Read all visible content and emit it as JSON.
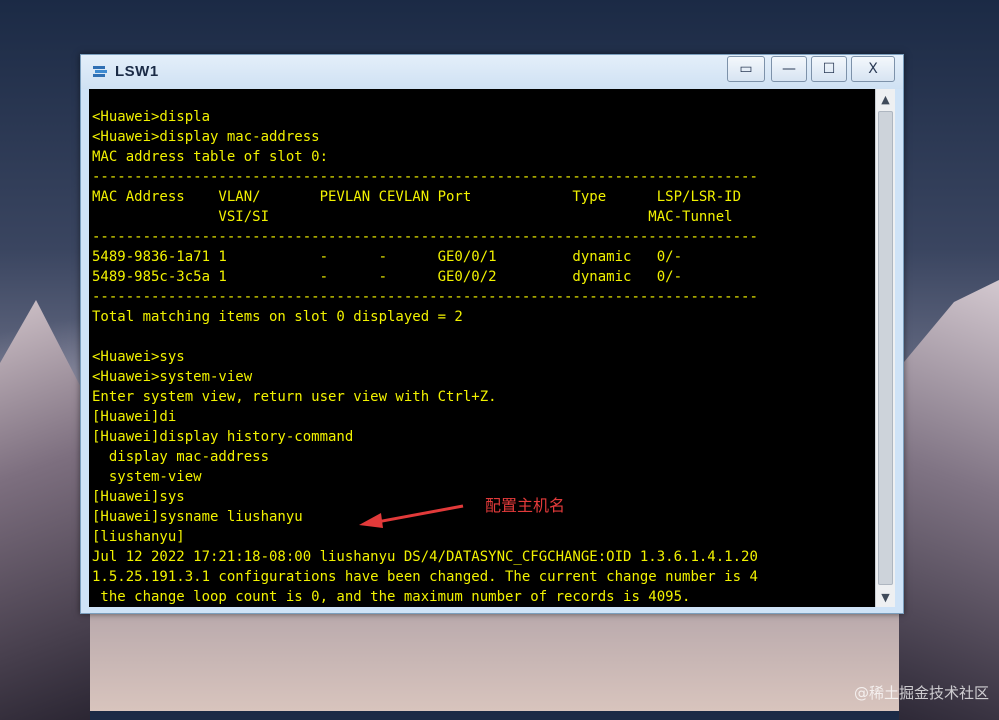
{
  "window": {
    "title": "LSW1",
    "controls": {
      "restore_glyph": "▭",
      "minimize_glyph": "—",
      "maximize_glyph": "☐",
      "close_glyph": "X"
    }
  },
  "terminal": {
    "text_color": "#f2f200",
    "lines": [
      "<Huawei>displa",
      "<Huawei>display mac-address",
      "MAC address table of slot 0:",
      "-------------------------------------------------------------------------------",
      "MAC Address    VLAN/       PEVLAN CEVLAN Port            Type      LSP/LSR-ID",
      "               VSI/SI                                             MAC-Tunnel",
      "-------------------------------------------------------------------------------",
      "5489-9836-1a71 1           -      -      GE0/0/1         dynamic   0/-",
      "5489-985c-3c5a 1           -      -      GE0/0/2         dynamic   0/-",
      "-------------------------------------------------------------------------------",
      "Total matching items on slot 0 displayed = 2",
      "",
      "<Huawei>sys",
      "<Huawei>system-view",
      "Enter system view, return user view with Ctrl+Z.",
      "[Huawei]di",
      "[Huawei]display history-command",
      "  display mac-address",
      "  system-view",
      "[Huawei]sys",
      "[Huawei]sysname liushanyu",
      "[liushanyu]",
      "Jul 12 2022 17:21:18-08:00 liushanyu DS/4/DATASYNC_CFGCHANGE:OID 1.3.6.1.4.1.20",
      "1.5.25.191.3.1 configurations have been changed. The current change number is 4",
      " the change loop count is 0, and the maximum number of records is 4095."
    ]
  },
  "annotation": {
    "text": "配置主机名",
    "color": "#e23a3a"
  },
  "scrollbar": {
    "up_glyph": "▲",
    "down_glyph": "▼"
  },
  "watermark": "@稀土掘金技术社区"
}
